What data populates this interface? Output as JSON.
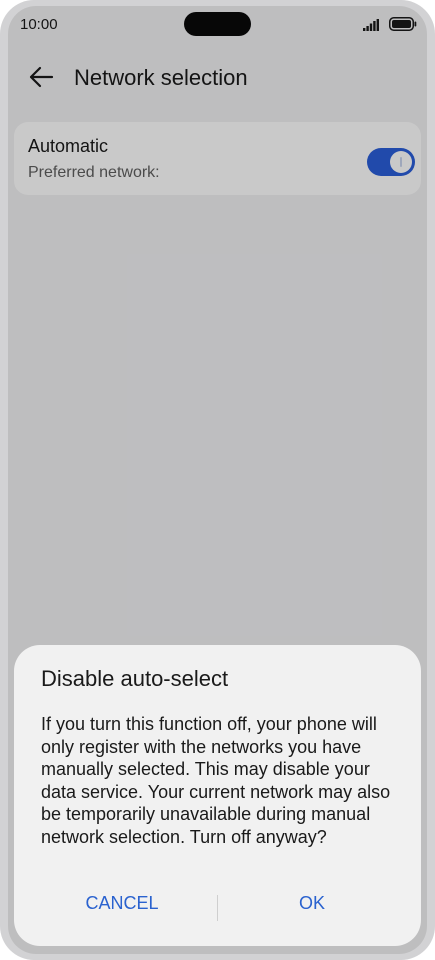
{
  "status_bar": {
    "time": "10:00",
    "signal_icon": "cellular-signal-icon",
    "battery_icon": "battery-icon"
  },
  "header": {
    "back_icon": "back-arrow-icon",
    "title": "Network selection"
  },
  "setting": {
    "title": "Automatic",
    "subtitle": "Preferred network:",
    "toggle_on": true
  },
  "dialog": {
    "title": "Disable auto-select",
    "message": "If you turn this function off, your phone will only register with the networks you have manually selected. This may disable your data service. Your current network may also be temporarily unavailable during manual network selection. Turn off anyway?",
    "cancel_label": "CANCEL",
    "ok_label": "OK"
  },
  "colors": {
    "accent": "#2b5fd9",
    "button_text": "#2a62cf",
    "background": "#f1f1f3",
    "dialog_background": "#f1f1f1"
  }
}
